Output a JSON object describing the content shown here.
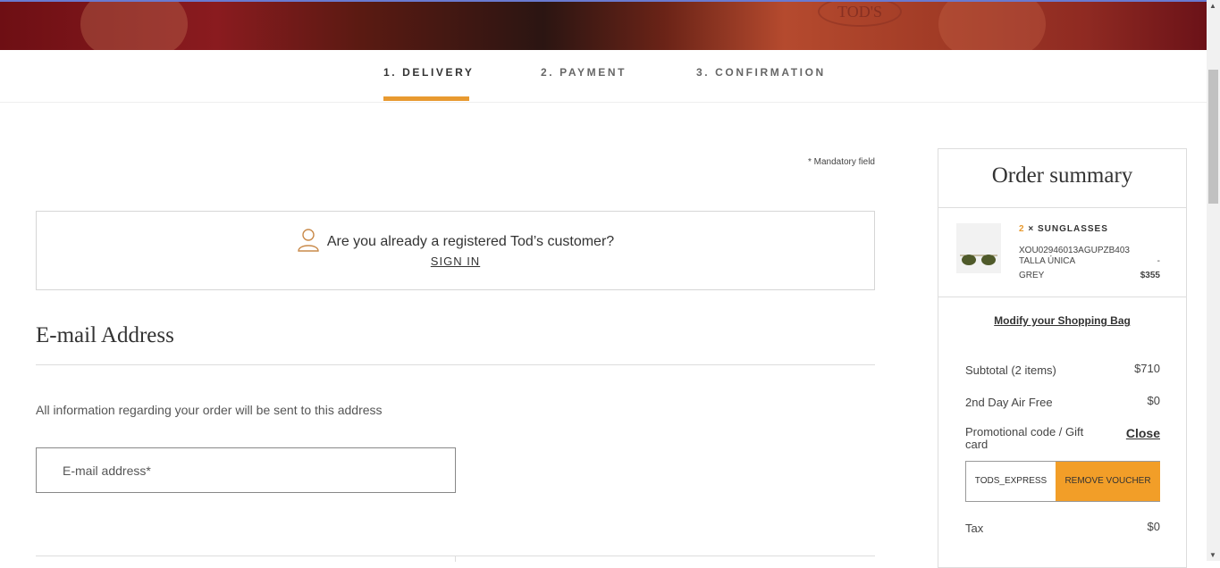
{
  "hero": {
    "logo_text": "TOD'S"
  },
  "steps": [
    {
      "label": "1. DELIVERY"
    },
    {
      "label": "2. PAYMENT"
    },
    {
      "label": "3. CONFIRMATION"
    }
  ],
  "form": {
    "mandatory_note": "* Mandatory field",
    "signin_question": "Are you already a registered Tod’s customer?",
    "signin_link": "SIGN IN",
    "email_title": "E-mail Address",
    "email_info": "All information regarding your order will be sent to this address",
    "email_placeholder": "E-mail address*",
    "email_value": ""
  },
  "summary": {
    "title": "Order summary",
    "product": {
      "qty": "2",
      "times": "×",
      "name": "SUNGLASSES",
      "sku": "XOU02946013AGUPZB403",
      "size": "TALLA ÚNICA",
      "color": "GREY",
      "dash": "-",
      "price": "$355"
    },
    "modify_link": "Modify your Shopping Bag",
    "subtotal_label": "Subtotal (2 items)",
    "subtotal_value": "$710",
    "shipping_label": "2nd Day Air Free",
    "shipping_value": "$0",
    "promo_label": "Promotional code / Gift card",
    "close_link": "Close",
    "voucher_code": "TODS_EXPRESS",
    "remove_voucher": "REMOVE VOUCHER",
    "tax_label": "Tax",
    "tax_value": "$0"
  },
  "colors": {
    "accent": "#e89a30",
    "voucher_button": "#f29e28"
  }
}
